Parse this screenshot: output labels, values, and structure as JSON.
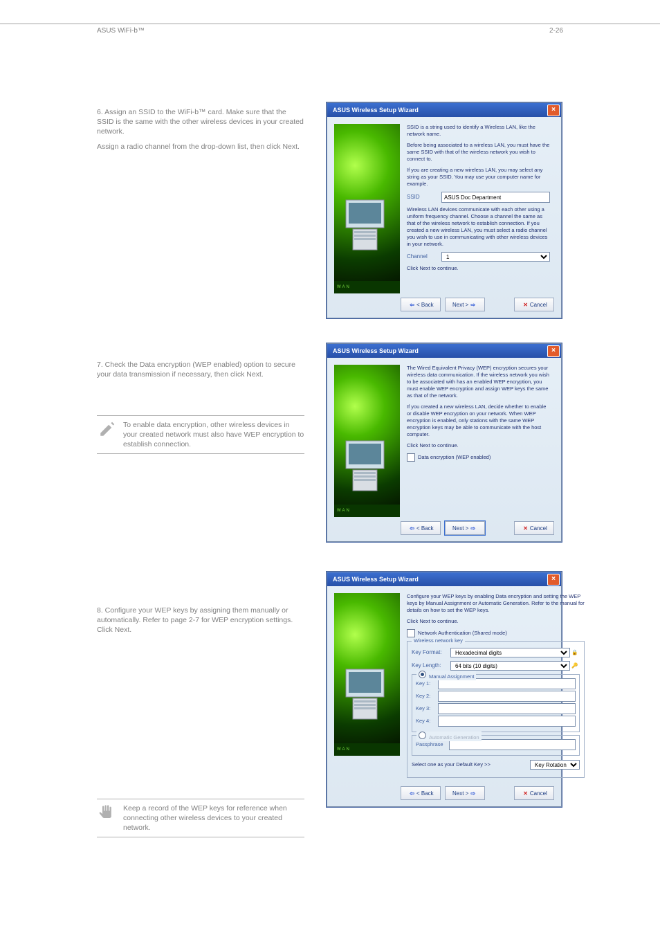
{
  "page": {
    "footer_left": "ASUS WiFi-b™",
    "footer_right": "2-26"
  },
  "steps": {
    "s6": "6.  Assign an SSID to the WiFi-b™ card. Make sure that the SSID is the same with the other wireless devices in your created network.",
    "s6b": "Assign a radio channel from the drop-down list, then click Next.",
    "s7": "7.  Check the Data encryption (WEP enabled) option to secure your data transmission if necessary, then click Next.",
    "s8": "8.  Configure your WEP keys by assigning them manually or automatically. Refer to page 2-7 for WEP encryption settings. Click Next."
  },
  "note1": {
    "text": "To enable data encryption, other wireless devices in your created network must also have WEP encryption to establish connection."
  },
  "note2": {
    "text": "Keep a record of the WEP keys for reference when connecting other wireless devices to your created network."
  },
  "wiz": {
    "title": "ASUS Wireless Setup Wizard",
    "back": "< Back",
    "next": "Next >",
    "cancel": "Cancel",
    "brand": "WAN"
  },
  "d1": {
    "p1": "SSID is a string used to identify a Wireless LAN, like the network name.",
    "p2": "Before being associated to a wireless LAN, you must have the same SSID with that of the wireless network you wish to connect to.",
    "p3": "If you are creating a new wireless LAN, you may select any string as your SSID. You may use your computer name for example.",
    "ssid_label": "SSID",
    "ssid_value": "ASUS Doc Department",
    "p4": "Wireless LAN devices communicate with each other using a uniform frequency channel. Choose a channel the same as that of the wireless network to establish connection. If you created a new wireless LAN, you must select a radio channel you wish to use in communicating with other wireless devices in your network.",
    "channel_label": "Channel",
    "channel_value": "1",
    "p5": "Click Next to continue."
  },
  "d2": {
    "p1": "The Wired Equivalent Privacy (WEP) encryption secures your wireless data communication. If the wireless network you wish to be associated with has an enabled WEP encryption, you must enable WEP encryption and assign WEP keys the same as that of the network.",
    "p2": "If you created a new wireless LAN, decide whether to enable or disable WEP encryption on your network. When WEP encryption is enabled, only stations with the same WEP encryption keys may be able to communicate with the host computer.",
    "p3": "Click Next to continue.",
    "wep_label": "Data encryption (WEP enabled)"
  },
  "d3": {
    "p1": "Configure your WEP keys by enabling Data encryption and setting the WEP keys by Manual Assignment or Automatic Generation. Refer to the manual for details on how to set the WEP keys.",
    "p2": "Click Next to continue.",
    "auth_label": "Network Authentication (Shared mode)",
    "group_title": "Wireless network key",
    "keyformat_label": "Key Format:",
    "keyformat_value": "Hexadecimal digits",
    "keylength_label": "Key Length:",
    "keylength_value": "64 bits (10 digits)",
    "manual_label": "Manual Assignment",
    "key1": "Key 1:",
    "key2": "Key 2:",
    "key3": "Key 3:",
    "key4": "Key 4:",
    "auto_label": "Automatic Generation",
    "pass_label": "Passphrase",
    "default_label": "Select one as your Default Key >>",
    "default_value": "Key Rotation"
  }
}
